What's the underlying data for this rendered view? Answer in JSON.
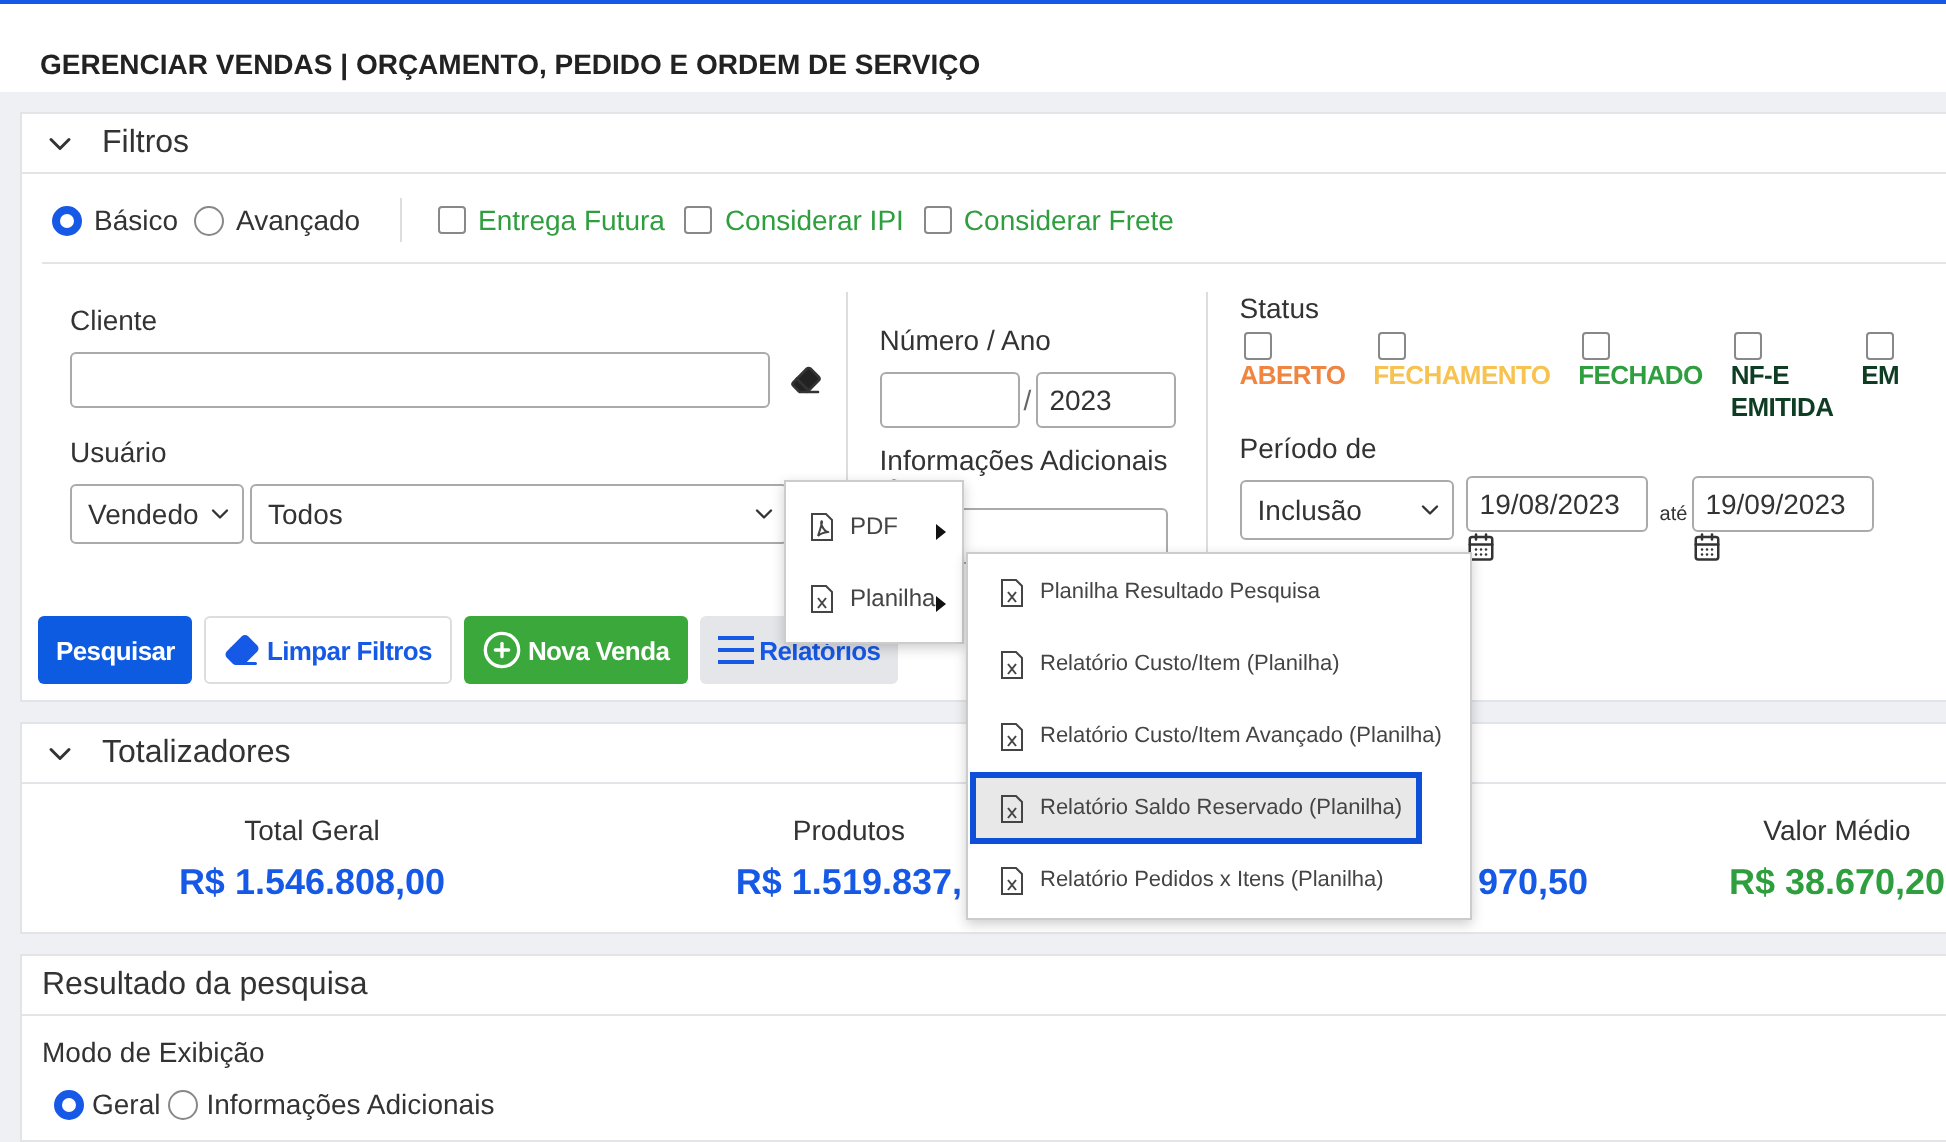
{
  "header": {
    "title": "GERENCIAR VENDAS | ORÇAMENTO, PEDIDO E ORDEM DE SERVIÇO"
  },
  "filters": {
    "title": "Filtros",
    "expanded": true,
    "modes": [
      {
        "label": "Básico",
        "selected": true
      },
      {
        "label": "Avançado",
        "selected": false
      }
    ],
    "options": [
      {
        "label": "Entrega Futura",
        "checked": false
      },
      {
        "label": "Considerar IPI",
        "checked": false
      },
      {
        "label": "Considerar Frete",
        "checked": false
      }
    ],
    "client_label": "Cliente",
    "user_label": "Usuário",
    "user_type": "Vendedo",
    "user_value": "Todos",
    "number_label": "Número / Ano",
    "separator": "/",
    "year": "2023",
    "info_label": "Informações Adicionais",
    "status_label": "Status",
    "statuses": [
      {
        "label": "ABERTO",
        "checked": false,
        "color": "#ef8540"
      },
      {
        "label": "FECHAMENTO",
        "checked": false,
        "color": "#f7c24f"
      },
      {
        "label": "FECHADO",
        "checked": false,
        "color": "#2e9e3e"
      },
      {
        "label": "NF-E EMITIDA",
        "checked": false,
        "color": "#0f3d24"
      },
      {
        "label": "EM",
        "checked": false,
        "color": "#0f3d24"
      }
    ],
    "period_label": "Período de",
    "period_type": "Inclusão",
    "date_from": "19/08/2023",
    "until": "até",
    "date_to": "19/09/2023",
    "buttons": [
      {
        "label": "Pesquisar",
        "kind": "primary"
      },
      {
        "label": "Limpar Filtros",
        "kind": "clear"
      },
      {
        "label": "Nova Venda",
        "kind": "new"
      },
      {
        "label": "Relatórios",
        "kind": "menu"
      }
    ]
  },
  "report_menu": {
    "items": [
      {
        "label": "PDF",
        "kind": "pdf"
      },
      {
        "label": "Planilha",
        "kind": "sheet"
      }
    ],
    "submenu": [
      {
        "label": "Planilha Resultado Pesquisa",
        "selected": false
      },
      {
        "label": "Relatório Custo/Item (Planilha)",
        "selected": false
      },
      {
        "label": "Relatório Custo/Item Avançado (Planilha)",
        "selected": false
      },
      {
        "label": "Relatório Saldo Reservado (Planilha)",
        "selected": true
      },
      {
        "label": "Relatório Pedidos x Itens (Planilha)",
        "selected": false
      }
    ]
  },
  "totals": {
    "title": "Totalizadores",
    "expanded": true,
    "items": [
      {
        "label": "Total Geral",
        "value": "R$ 1.546.808,00",
        "color": "#1659e6"
      },
      {
        "label": "Produtos",
        "value": "R$ 1.519.837,",
        "color": "#1659e6"
      },
      {
        "value": "970,50",
        "color": "#1659e6"
      },
      {
        "label": "Valor Médio",
        "value": "R$ 38.670,20",
        "color": "#2e9e3e"
      }
    ]
  },
  "results": {
    "title": "Resultado da pesquisa",
    "mode_label": "Modo de Exibição",
    "modes": [
      {
        "label": "Geral",
        "selected": true
      },
      {
        "label": "Informações Adicionais",
        "selected": false
      }
    ]
  }
}
